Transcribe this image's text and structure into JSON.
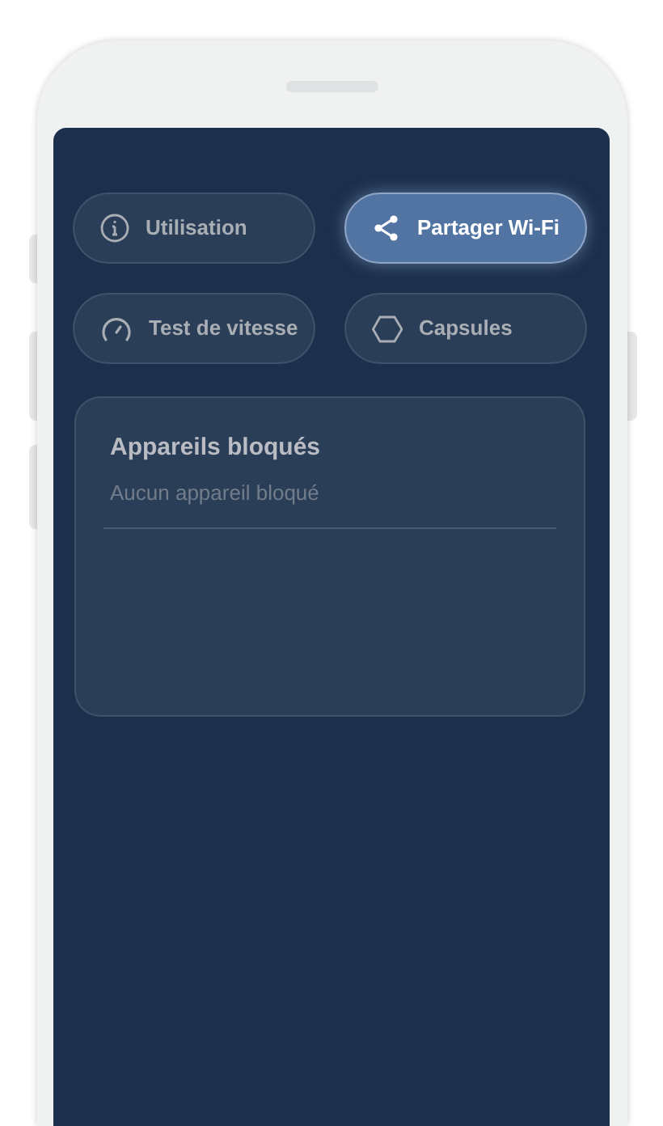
{
  "actions": [
    {
      "label": "Utilisation",
      "selected": false
    },
    {
      "label": "Partager Wi-Fi",
      "selected": true
    },
    {
      "label": "Test de vitesse",
      "selected": false
    },
    {
      "label": "Capsules",
      "selected": false
    }
  ],
  "blocked_devices": {
    "title": "Appareils bloqués",
    "empty_message": "Aucun appareil bloqué"
  }
}
